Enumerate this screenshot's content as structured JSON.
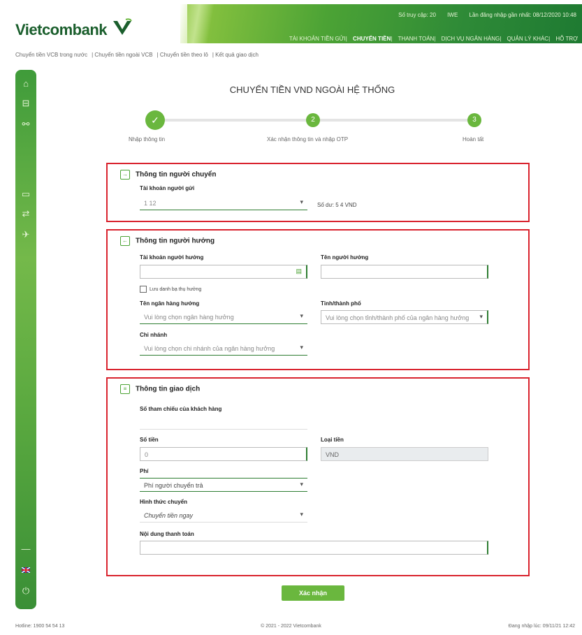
{
  "header": {
    "logo_text": "Vietcombank",
    "info": [
      "Số truy cập: 20",
      "IWE",
      "Lần đăng nhập gần nhất: 08/12/2020 10:48"
    ],
    "nav": [
      "TÀI KHOẢN TIỀN GỬI",
      "CHUYỂN TIỀN",
      "THANH TOÁN",
      "DỊCH VỤ NGÂN HÀNG",
      "QUẢN LÝ KHÁC",
      "HỖ TRỢ"
    ],
    "active_nav": "CHUYỂN TIỀN"
  },
  "subnav": [
    "Chuyển tiền VCB trong nước",
    "Chuyển tiền ngoài VCB",
    "Chuyển tiền theo lô",
    "Kết quả giao dịch"
  ],
  "sidebar": {
    "icons": [
      "home-icon",
      "car-icon",
      "link-icon",
      "card-icon",
      "transfer-icon",
      "send-icon",
      "minus-icon",
      "flag-icon",
      "power-icon"
    ]
  },
  "page": {
    "title": "CHUYỂN TIỀN VND NGOÀI HỆ THỐNG",
    "steps": [
      {
        "label": "Nhập thông tin",
        "marker": "✓"
      },
      {
        "label": "Xác nhận thông tin và nhập OTP",
        "marker": "2"
      },
      {
        "label": "Hoàn tất",
        "marker": "3"
      }
    ],
    "submit_label": "Xác nhận"
  },
  "sender": {
    "heading": "Thông tin người chuyển",
    "account_label": "Tài khoản người gửi",
    "account_value": "1          12",
    "balance_text": "Số dư: 5    4 VND"
  },
  "beneficiary": {
    "heading": "Thông tin người hưởng",
    "account_label": "Tài khoản người hưởng",
    "name_label": "Tên người hưởng",
    "save_label": "Lưu danh bạ thụ hưởng",
    "bank_label": "Tên ngân hàng hưởng",
    "bank_placeholder": "Vui lòng chọn ngân hàng hưởng",
    "province_label": "Tỉnh/thành phố",
    "province_placeholder": "Vui lòng chọn tỉnh/thành phố của ngân hàng hưởng",
    "branch_label": "Chi nhánh",
    "branch_placeholder": "Vui lòng chọn chi nhánh của ngân hàng hưởng"
  },
  "transaction": {
    "heading": "Thông tin giao dịch",
    "ref_label": "Số tham chiếu của khách hàng",
    "amount_label": "Số tiền",
    "amount_value": "0",
    "currency_label": "Loại tiền",
    "currency_value": "VND",
    "fee_label": "Phí",
    "fee_value": "Phí người chuyển trả",
    "method_label": "Hình thức chuyển",
    "method_value": "Chuyển tiền ngay",
    "content_label": "Nội dung thanh toán"
  },
  "footer": {
    "left": "Hotline: 1900 54 54 13",
    "mid": "© 2021 - 2022 Vietcombank",
    "right": "Đang nhập lúc: 09/11/21 12:42"
  }
}
